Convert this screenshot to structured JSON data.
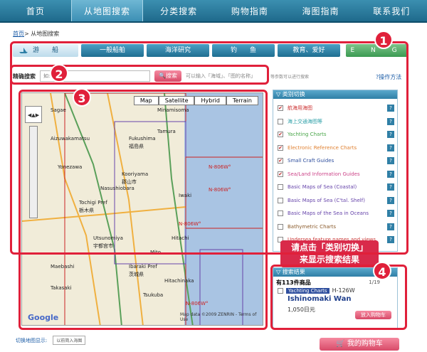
{
  "nav": [
    "首页",
    "从地图搜索",
    "分类搜索",
    "购物指南",
    "海图指南",
    "联系我们"
  ],
  "breadcrumb": {
    "home": "首页",
    "current": "> 从地图搜索"
  },
  "categories": [
    "游　　船",
    "一般船舶",
    "海洋研究",
    "钓　　鱼",
    "教育、爱好",
    "E N G"
  ],
  "search": {
    "label": "精确搜索",
    "placeholder": "如:W90",
    "button": "搜索",
    "hint": "可以输入「海域」、「图的名称」",
    "hint2": "等参数可以进行搜索"
  },
  "help_link": "操作方法",
  "map": {
    "types": [
      "Map",
      "Satellite",
      "Hybrid",
      "Terrain"
    ],
    "labels": [
      "Minamisoma",
      "Fukushima",
      "福島県",
      "Kooriyama",
      "郡山市",
      "Iwaki",
      "Hitachi",
      "Mito",
      "Tsukuba",
      "Utsunomiya",
      "宇都宫市",
      "Tochigi Pref",
      "栃木県",
      "Ibaraki Pref",
      "茨城県",
      "Hitachinaka",
      "Maebashi",
      "Takasaki",
      "Nasushiobara",
      "Aizuwakamatsu",
      "Sagae",
      "Yonezawa",
      "Tamura"
    ],
    "lat_labels": [
      "N-806W°",
      "N-806W°",
      "N-806W°",
      "N-806W°"
    ],
    "google": "Google",
    "copyright": "Map data ©2009 ZENRIN - Terms of Use"
  },
  "sidebar": {
    "header": "类别切换",
    "items": [
      {
        "label": "航海用海图",
        "checked": true,
        "color": "#cc3333"
      },
      {
        "label": "海上交通海图等",
        "checked": false,
        "color": "#2ea0a8"
      },
      {
        "label": "Yachting Charts",
        "checked": true,
        "color": "#4aa64a"
      },
      {
        "label": "Electronic Reference Charts",
        "checked": true,
        "color": "#e08030"
      },
      {
        "label": "Small Craft Guides",
        "checked": true,
        "color": "#2f4f9e"
      },
      {
        "label": "Sea/Land Information Guides",
        "checked": true,
        "color": "#cc4488"
      },
      {
        "label": "Basic Maps of Sea (Coastal)",
        "checked": false,
        "color": "#6644aa"
      },
      {
        "label": "Basic Maps of Sea (C'tal. Shelf)",
        "checked": false,
        "color": "#6644aa"
      },
      {
        "label": "Basic Maps of the Sea in Oceans",
        "checked": false,
        "color": "#6644aa"
      },
      {
        "label": "Bathymetric Charts",
        "checked": false,
        "color": "#8a5a2a"
      },
      {
        "label": "Undersea feature names and views",
        "checked": false,
        "color": "#cc3333"
      }
    ]
  },
  "callout": [
    "请点击「类别切换」",
    "来显示搜索结果"
  ],
  "results": {
    "header": "搜索结果",
    "count": "有113件商品",
    "page": "1/19",
    "badge": "Yachting Charts",
    "code": "H-126W",
    "title": "Ishinomaki Wan",
    "price": "1,050日元",
    "cart": "放入购物车"
  },
  "switch": {
    "label": "切换地图显示:",
    "box": "以前简入海图"
  },
  "mycart": "我的购物车",
  "annotations": [
    "1",
    "2",
    "3",
    "4"
  ]
}
